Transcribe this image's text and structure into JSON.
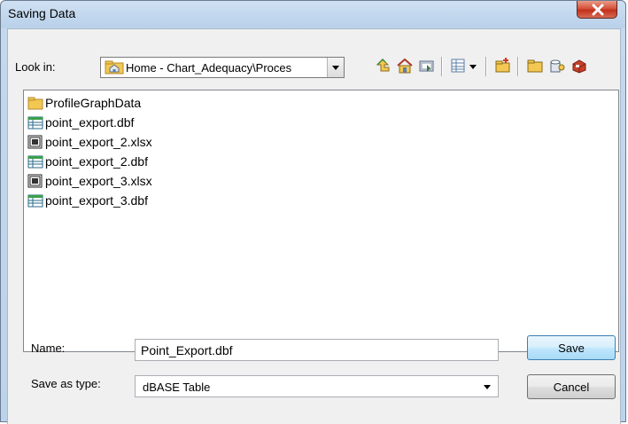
{
  "window": {
    "title": "Saving Data",
    "close_icon": "close-icon",
    "accent": "#c2301a"
  },
  "lookin": {
    "label": "Look in:",
    "value": "Home - Chart_Adequacy\\Proces",
    "icon": "folder-home-icon"
  },
  "toolbar": {
    "icons": [
      "up-one-level-icon",
      "home-icon",
      "catalog-connect-icon",
      "view-menu-icon",
      "new-folder-icon",
      "folder-icon",
      "database-icon",
      "toolbox-icon"
    ]
  },
  "files": [
    {
      "name": "ProfileGraphData",
      "icon": "folder-icon"
    },
    {
      "name": "point_export.dbf",
      "icon": "table-icon"
    },
    {
      "name": "point_export_2.xlsx",
      "icon": "excel-icon"
    },
    {
      "name": "point_export_2.dbf",
      "icon": "table-icon"
    },
    {
      "name": "point_export_3.xlsx",
      "icon": "excel-icon"
    },
    {
      "name": "point_export_3.dbf",
      "icon": "table-icon"
    }
  ],
  "form": {
    "name_label": "Name:",
    "name_value": "Point_Export.dbf",
    "type_label": "Save as type:",
    "type_value": "dBASE Table"
  },
  "buttons": {
    "save": "Save",
    "cancel": "Cancel"
  }
}
